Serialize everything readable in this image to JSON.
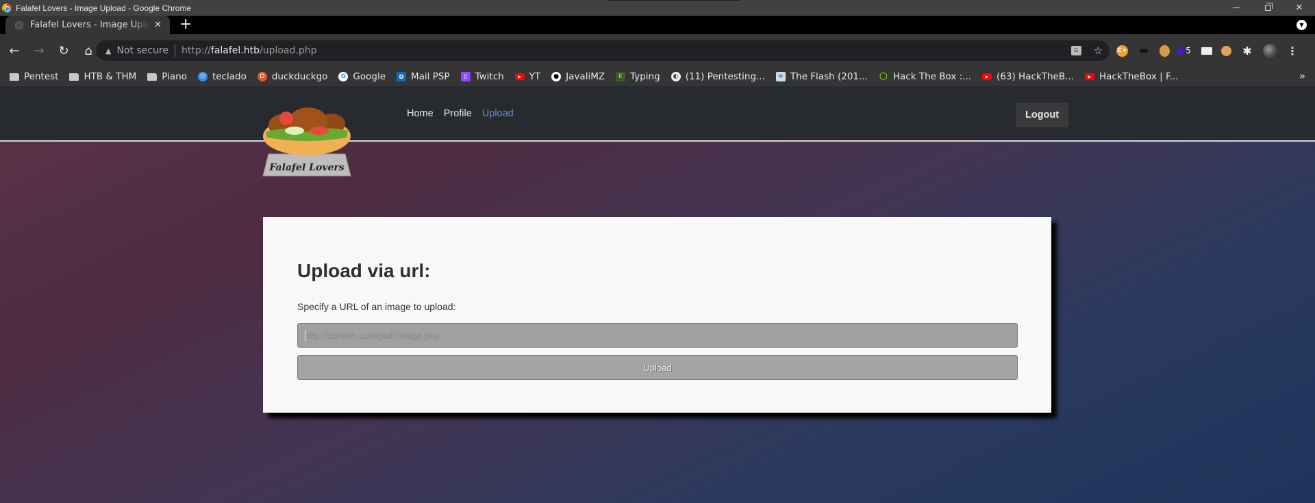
{
  "window": {
    "title": "Falafel Lovers - Image Upload - Google Chrome",
    "controls": {
      "minimize": "minimize",
      "restore": "restore",
      "close": "✕"
    }
  },
  "tabs": [
    {
      "title": "Falafel Lovers - Image Upload",
      "close": "✕",
      "active": true
    }
  ],
  "new_tab_label": "+",
  "tab_search_glyph": "▼",
  "toolbar": {
    "back": "←",
    "forward": "→",
    "reload": "↻",
    "home": "⌂",
    "security_warning_glyph": "▲",
    "security_label": "Not secure",
    "url": {
      "scheme": "http://",
      "host": "falafel.htb",
      "path": "/upload.php"
    },
    "translate_glyph": "G",
    "bookmark_star": "☆",
    "extensions": [
      {
        "name": "cplus",
        "glyph": "C+"
      },
      {
        "name": "hat",
        "glyph": "▬"
      },
      {
        "name": "cookie",
        "glyph": ""
      },
      {
        "name": "gem",
        "glyph": "",
        "badge": "5"
      },
      {
        "name": "box",
        "glyph": ""
      },
      {
        "name": "fox",
        "glyph": ""
      },
      {
        "name": "puzzle",
        "glyph": "✱"
      },
      {
        "name": "profile-avatar",
        "glyph": ""
      }
    ],
    "menu_glyph": "⋮"
  },
  "bookmarks": [
    {
      "label": "Pentest",
      "icon": "folder",
      "glyph": ""
    },
    {
      "label": "HTB & THM",
      "icon": "folder",
      "glyph": ""
    },
    {
      "label": "Piano",
      "icon": "folder",
      "glyph": ""
    },
    {
      "label": "teclado",
      "icon": "teclado",
      "glyph": "⏻"
    },
    {
      "label": "duckduckgo",
      "icon": "ddg",
      "glyph": "D"
    },
    {
      "label": "Google",
      "icon": "google",
      "glyph": "G"
    },
    {
      "label": "Mail PSP",
      "icon": "outlook",
      "glyph": "O"
    },
    {
      "label": "Twitch",
      "icon": "twitch",
      "glyph": "▯"
    },
    {
      "label": "YT",
      "icon": "yt",
      "glyph": "▶"
    },
    {
      "label": "JavaliMZ",
      "icon": "github",
      "glyph": "●"
    },
    {
      "label": "Typing",
      "icon": "typing",
      "glyph": "K"
    },
    {
      "label": "(11) Pentesting...",
      "icon": "globe",
      "glyph": "◐"
    },
    {
      "label": "The Flash (201...",
      "icon": "flash",
      "glyph": "≋"
    },
    {
      "label": "Hack The Box :...",
      "icon": "htb",
      "glyph": "⬡"
    },
    {
      "label": "(63) HackTheB...",
      "icon": "yt",
      "glyph": "▶"
    },
    {
      "label": "HackTheBox | F...",
      "icon": "yt",
      "glyph": "▶"
    }
  ],
  "bookmarks_overflow": "»",
  "site": {
    "logo_text": "Falafel Lovers",
    "nav": [
      {
        "label": "Home",
        "active": false
      },
      {
        "label": "Profile",
        "active": false
      },
      {
        "label": "Upload",
        "active": true
      }
    ],
    "logout_label": "Logout",
    "accent_color": "#5f8fcf"
  },
  "upload_form": {
    "heading": "Upload via url:",
    "description": "Specify a URL of an image to upload:",
    "url_input": {
      "value": "",
      "placeholder": "http://domain.com/path/image.png"
    },
    "submit_label": "Upload"
  }
}
